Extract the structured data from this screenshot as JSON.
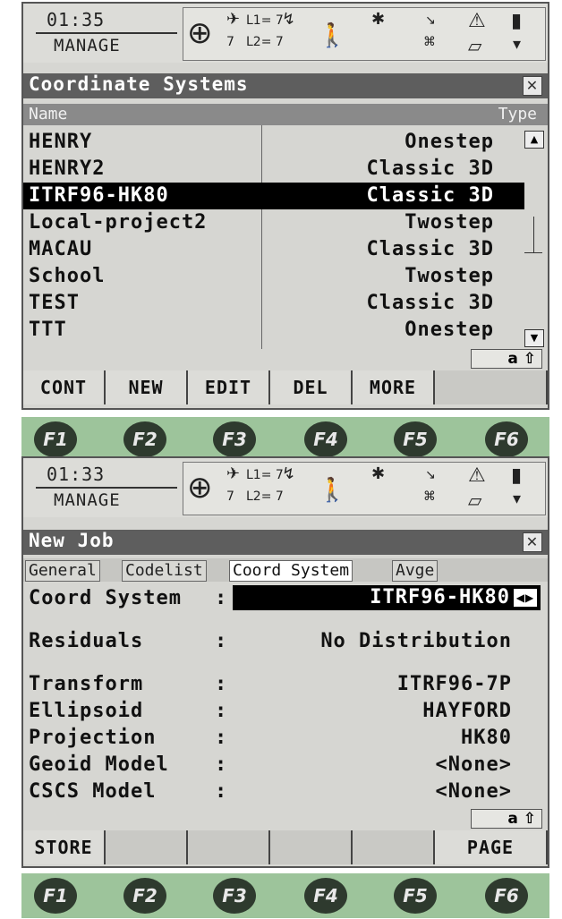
{
  "screen1": {
    "time": "01:35",
    "mode": "MANAGE",
    "status": {
      "sats": "7",
      "l1": "L1= 7",
      "l2": "L2= 7"
    },
    "title": "Coordinate Systems",
    "columns": {
      "name": "Name",
      "type": "Type"
    },
    "rows": [
      {
        "name": "HENRY",
        "type": "Onestep"
      },
      {
        "name": "HENRY2",
        "type": "Classic 3D"
      },
      {
        "name": "ITRF96-HK80",
        "type": "Classic 3D"
      },
      {
        "name": "Local-project2",
        "type": "Twostep"
      },
      {
        "name": "MACAU",
        "type": "Classic 3D"
      },
      {
        "name": "School",
        "type": "Twostep"
      },
      {
        "name": "TEST",
        "type": "Classic 3D"
      },
      {
        "name": "TTT",
        "type": "Onestep"
      }
    ],
    "selected_row": 2,
    "input_mode": "a ⇧",
    "softkeys": [
      "CONT",
      "NEW",
      "EDIT",
      "DEL",
      "MORE",
      ""
    ]
  },
  "screen2": {
    "time": "01:33",
    "mode": "MANAGE",
    "status": {
      "sats": "7",
      "l1": "L1= 7",
      "l2": "L2= 7"
    },
    "title": "New Job",
    "tabs": [
      "General",
      "Codelist",
      "Coord System",
      "Avge"
    ],
    "active_tab": 2,
    "coord_system": {
      "label": "Coord System",
      "value": "ITRF96-HK80"
    },
    "fields": [
      {
        "label": "Residuals",
        "value": "No Distribution"
      },
      {
        "label": "Transform",
        "value": "ITRF96-7P"
      },
      {
        "label": "Ellipsoid",
        "value": "HAYFORD"
      },
      {
        "label": "Projection",
        "value": "HK80"
      },
      {
        "label": "Geoid Model",
        "value": "<None>"
      },
      {
        "label": "CSCS Model",
        "value": "<None>"
      }
    ],
    "input_mode": "a ⇧",
    "softkeys": [
      "STORE",
      "",
      "",
      "",
      "",
      "PAGE"
    ]
  },
  "fkeys": [
    "F1",
    "F2",
    "F3",
    "F4",
    "F5",
    "F6"
  ],
  "colors": {
    "title_bar": "#5e5e5e",
    "selection": "#000000",
    "fkey_bar": "#9dc49b"
  }
}
